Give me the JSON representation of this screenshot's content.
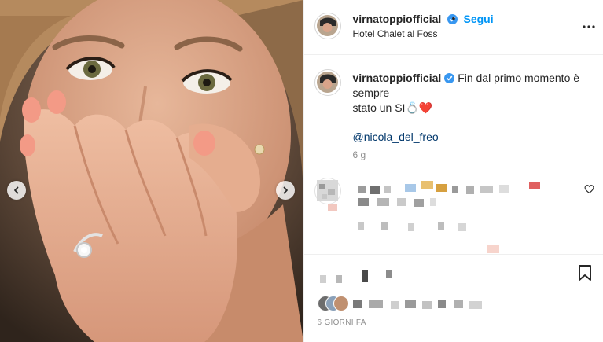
{
  "post": {
    "username": "virnatoppiofficial",
    "separator": "•",
    "follow_label": "Segui",
    "location": "Hotel Chalet al Foss",
    "caption_line1": "Fin dal primo momento è sempre",
    "caption_line2": "stato un SI",
    "caption_emoji": "💍❤️",
    "mention": "@nicola_del_freo",
    "relative_time": "6 g",
    "date_label": "6 GIORNI FA"
  },
  "icons": {
    "verified": "verified-badge-icon",
    "more": "more-options-icon",
    "prev": "chevron-left-icon",
    "next": "chevron-right-icon",
    "heart": "heart-icon",
    "bookmark": "bookmark-icon"
  },
  "colors": {
    "link": "#0095f6",
    "mention": "#00376b",
    "secondary_text": "#8e8e8e",
    "verified": "#3897f0"
  }
}
